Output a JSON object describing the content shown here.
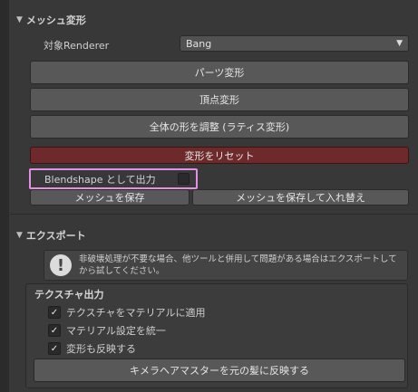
{
  "mesh_section": {
    "title": "メッシュ変形",
    "renderer_label": "対象Renderer",
    "renderer_value": "Bang",
    "parts_button": "パーツ変形",
    "vertex_button": "頂点変形",
    "lattice_button": "全体の形を調整 (ラティス変形)",
    "reset_button": "変形をリセット",
    "blendshape_label": "Blendshape として出力",
    "save_mesh_button": "メッシュを保存",
    "save_replace_button": "メッシュを保存して入れ替え"
  },
  "export_section": {
    "title": "エクスポート",
    "help_text": "非破壊処理が不要な場合、他ツールと併用して問題がある場合はエクスポートしてから試してください。",
    "help_icon": "!",
    "texture_title": "テクスチャ出力",
    "options": [
      {
        "label": "テクスチャをマテリアルに適用",
        "checked": true
      },
      {
        "label": "マテリアル設定を統一",
        "checked": true
      },
      {
        "label": "変形も反映する",
        "checked": true
      }
    ],
    "apply_button": "キメラヘアマスターを元の髪に反映する"
  },
  "icons": {
    "expand": "▼",
    "caret": "▼",
    "check": "✓"
  },
  "colors": {
    "highlight_border": "#e58ee8",
    "reset_button": "#6e2a2a"
  }
}
